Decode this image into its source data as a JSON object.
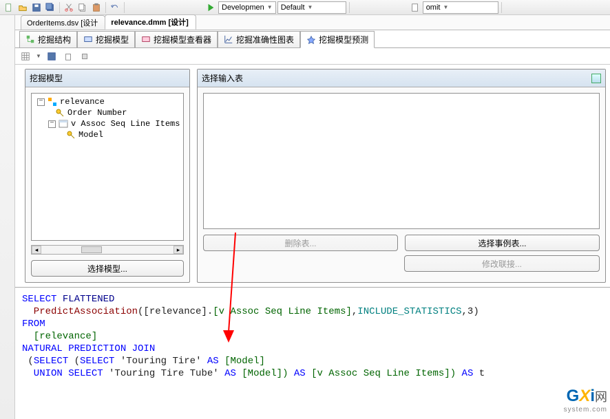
{
  "toolbar": {
    "combo1": "Developmen",
    "combo2": "Default",
    "combo3": "omit"
  },
  "tabs": {
    "file1": "OrderItems.dsv [设计",
    "file2": "relevance.dmm [设计]"
  },
  "subtabs": {
    "t1": "挖掘结构",
    "t2": "挖掘模型",
    "t3": "挖掘模型查看器",
    "t4": "挖掘准确性图表",
    "t5": "挖掘模型预测"
  },
  "panels": {
    "left_title": "挖掘模型",
    "right_title": "选择输入表",
    "tree": {
      "root": "relevance",
      "child1": "Order Number",
      "child2": "v Assoc Seq Line Items",
      "grandchild": "Model"
    },
    "select_model_btn": "选择模型...",
    "delete_table_btn": "删除表...",
    "select_case_btn": "选择事例表...",
    "modify_join_btn": "修改联接..."
  },
  "sql": {
    "line1_a": "SELECT",
    "line1_b": " FLATTENED",
    "line2_a": "  PredictAssociation",
    "line2_b": "([relevance].",
    "line2_c": "[v Assoc Seq Line Items]",
    "line2_d": ",",
    "line2_e": "INCLUDE_STATISTICS",
    "line2_f": ",3)",
    "line3": "FROM",
    "line4": "  [relevance]",
    "line5": "NATURAL PREDICTION JOIN",
    "line6_a": " (",
    "line6_b": "SELECT",
    "line6_c": " (",
    "line6_d": "SELECT",
    "line6_e": " 'Touring Tire' ",
    "line6_f": "AS",
    "line6_g": " [Model]",
    "line7_a": "  UNION",
    "line7_b": " SELECT",
    "line7_c": " 'Touring Tire Tube' ",
    "line7_d": "AS",
    "line7_e": " [Model]) ",
    "line7_f": "AS",
    "line7_g": " [v Assoc Seq Line Items]) ",
    "line7_h": "AS",
    "line7_i": " t"
  },
  "watermark": {
    "text": "网",
    "url": "system.com"
  }
}
